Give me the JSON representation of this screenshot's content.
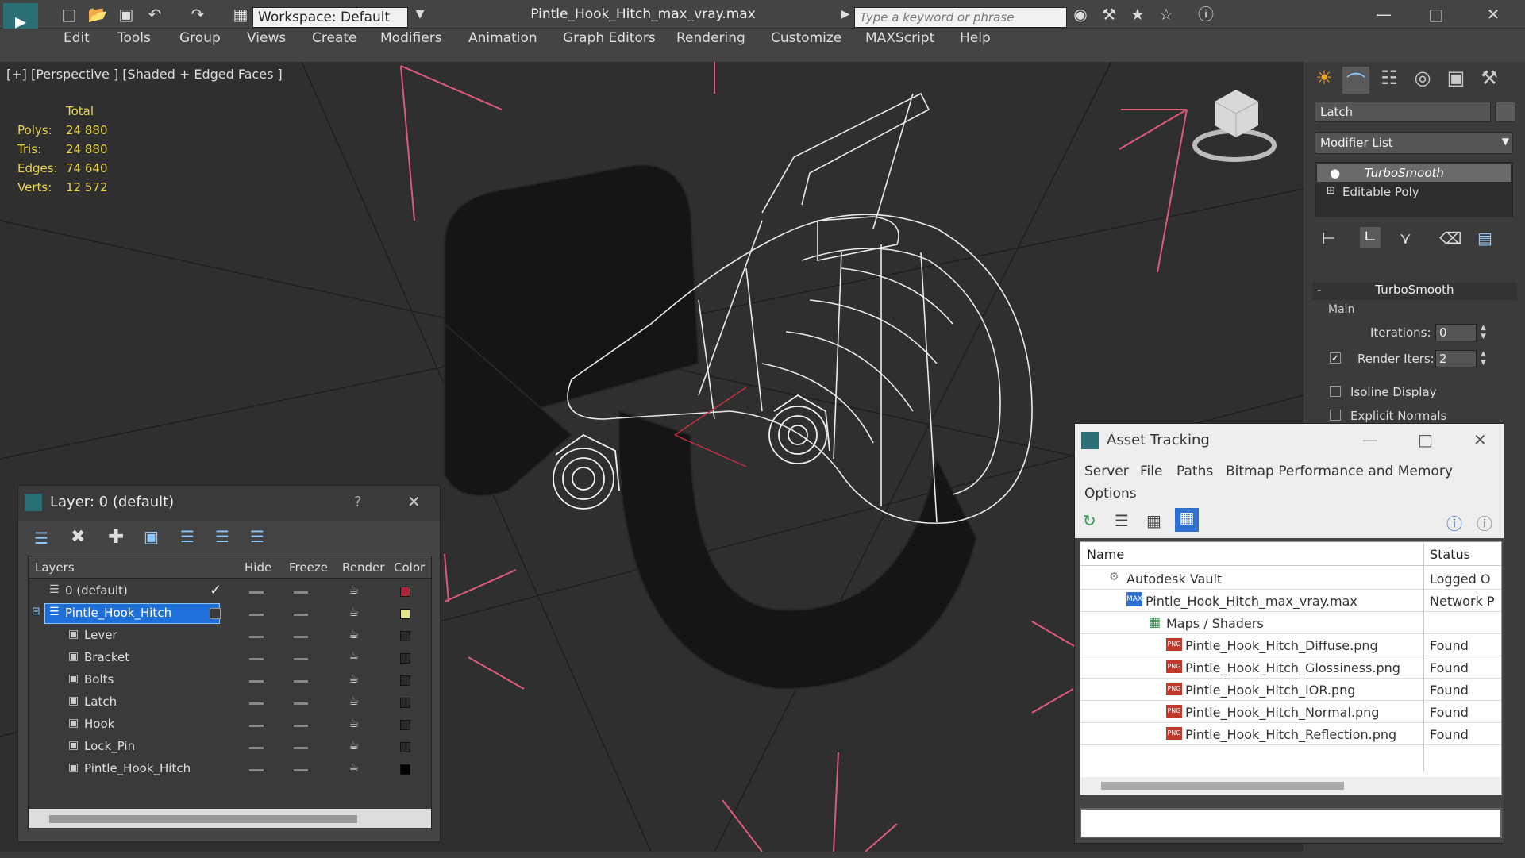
{
  "app": {
    "file_title": "Pintle_Hook_Hitch_max_vray.max",
    "workspace": "Workspace: Default",
    "search_placeholder": "Type a keyword or phrase"
  },
  "menu": [
    "Edit",
    "Tools",
    "Group",
    "Views",
    "Create",
    "Modifiers",
    "Animation",
    "Graph Editors",
    "Rendering",
    "Customize",
    "MAXScript",
    "Help"
  ],
  "viewport": {
    "label": "[+] [Perspective ] [Shaded + Edged Faces ]",
    "stats_header": "Total",
    "stats": [
      {
        "label": "Polys:",
        "value": "24 880"
      },
      {
        "label": "Tris:",
        "value": "24 880"
      },
      {
        "label": "Edges:",
        "value": "74 640"
      },
      {
        "label": "Verts:",
        "value": "12 572"
      }
    ]
  },
  "command_panel": {
    "object_name": "Latch",
    "modifier_list": "Modifier List",
    "stack": [
      "TurboSmooth",
      "Editable Poly"
    ],
    "rollout_title": "TurboSmooth",
    "group_main": "Main",
    "iterations_label": "Iterations:",
    "iterations_value": "0",
    "render_iters_label": "Render Iters:",
    "render_iters_value": "2",
    "isoline_label": "Isoline Display",
    "explicit_label": "Explicit Normals"
  },
  "layer_window": {
    "title": "Layer: 0 (default)",
    "help": "?",
    "columns": [
      "Layers",
      "Hide",
      "Freeze",
      "Render",
      "Color"
    ],
    "rows": [
      {
        "name": "0 (default)",
        "color": "#b0213a"
      },
      {
        "name": "Pintle_Hook_Hitch",
        "color": "#e5e58a"
      },
      {
        "name": "Lever",
        "color": "#2a2a2a"
      },
      {
        "name": "Bracket",
        "color": "#2a2a2a"
      },
      {
        "name": "Bolts",
        "color": "#2a2a2a"
      },
      {
        "name": "Latch",
        "color": "#2a2a2a"
      },
      {
        "name": "Hook",
        "color": "#2a2a2a"
      },
      {
        "name": "Lock_Pin",
        "color": "#2a2a2a"
      },
      {
        "name": "Pintle_Hook_Hitch",
        "color": "#000000"
      }
    ]
  },
  "asset_window": {
    "title": "Asset Tracking",
    "menu": [
      "Server",
      "File",
      "Paths",
      "Bitmap Performance and Memory",
      "Options"
    ],
    "columns": [
      "Name",
      "Status"
    ],
    "rows": [
      {
        "name": "Autodesk Vault",
        "status": "Logged O"
      },
      {
        "name": "Pintle_Hook_Hitch_max_vray.max",
        "status": "Network P"
      },
      {
        "name": "Maps / Shaders",
        "status": ""
      },
      {
        "name": "Pintle_Hook_Hitch_Diffuse.png",
        "status": "Found"
      },
      {
        "name": "Pintle_Hook_Hitch_Glossiness.png",
        "status": "Found"
      },
      {
        "name": "Pintle_Hook_Hitch_IOR.png",
        "status": "Found"
      },
      {
        "name": "Pintle_Hook_Hitch_Normal.png",
        "status": "Found"
      },
      {
        "name": "Pintle_Hook_Hitch_Reflection.png",
        "status": "Found"
      }
    ]
  }
}
